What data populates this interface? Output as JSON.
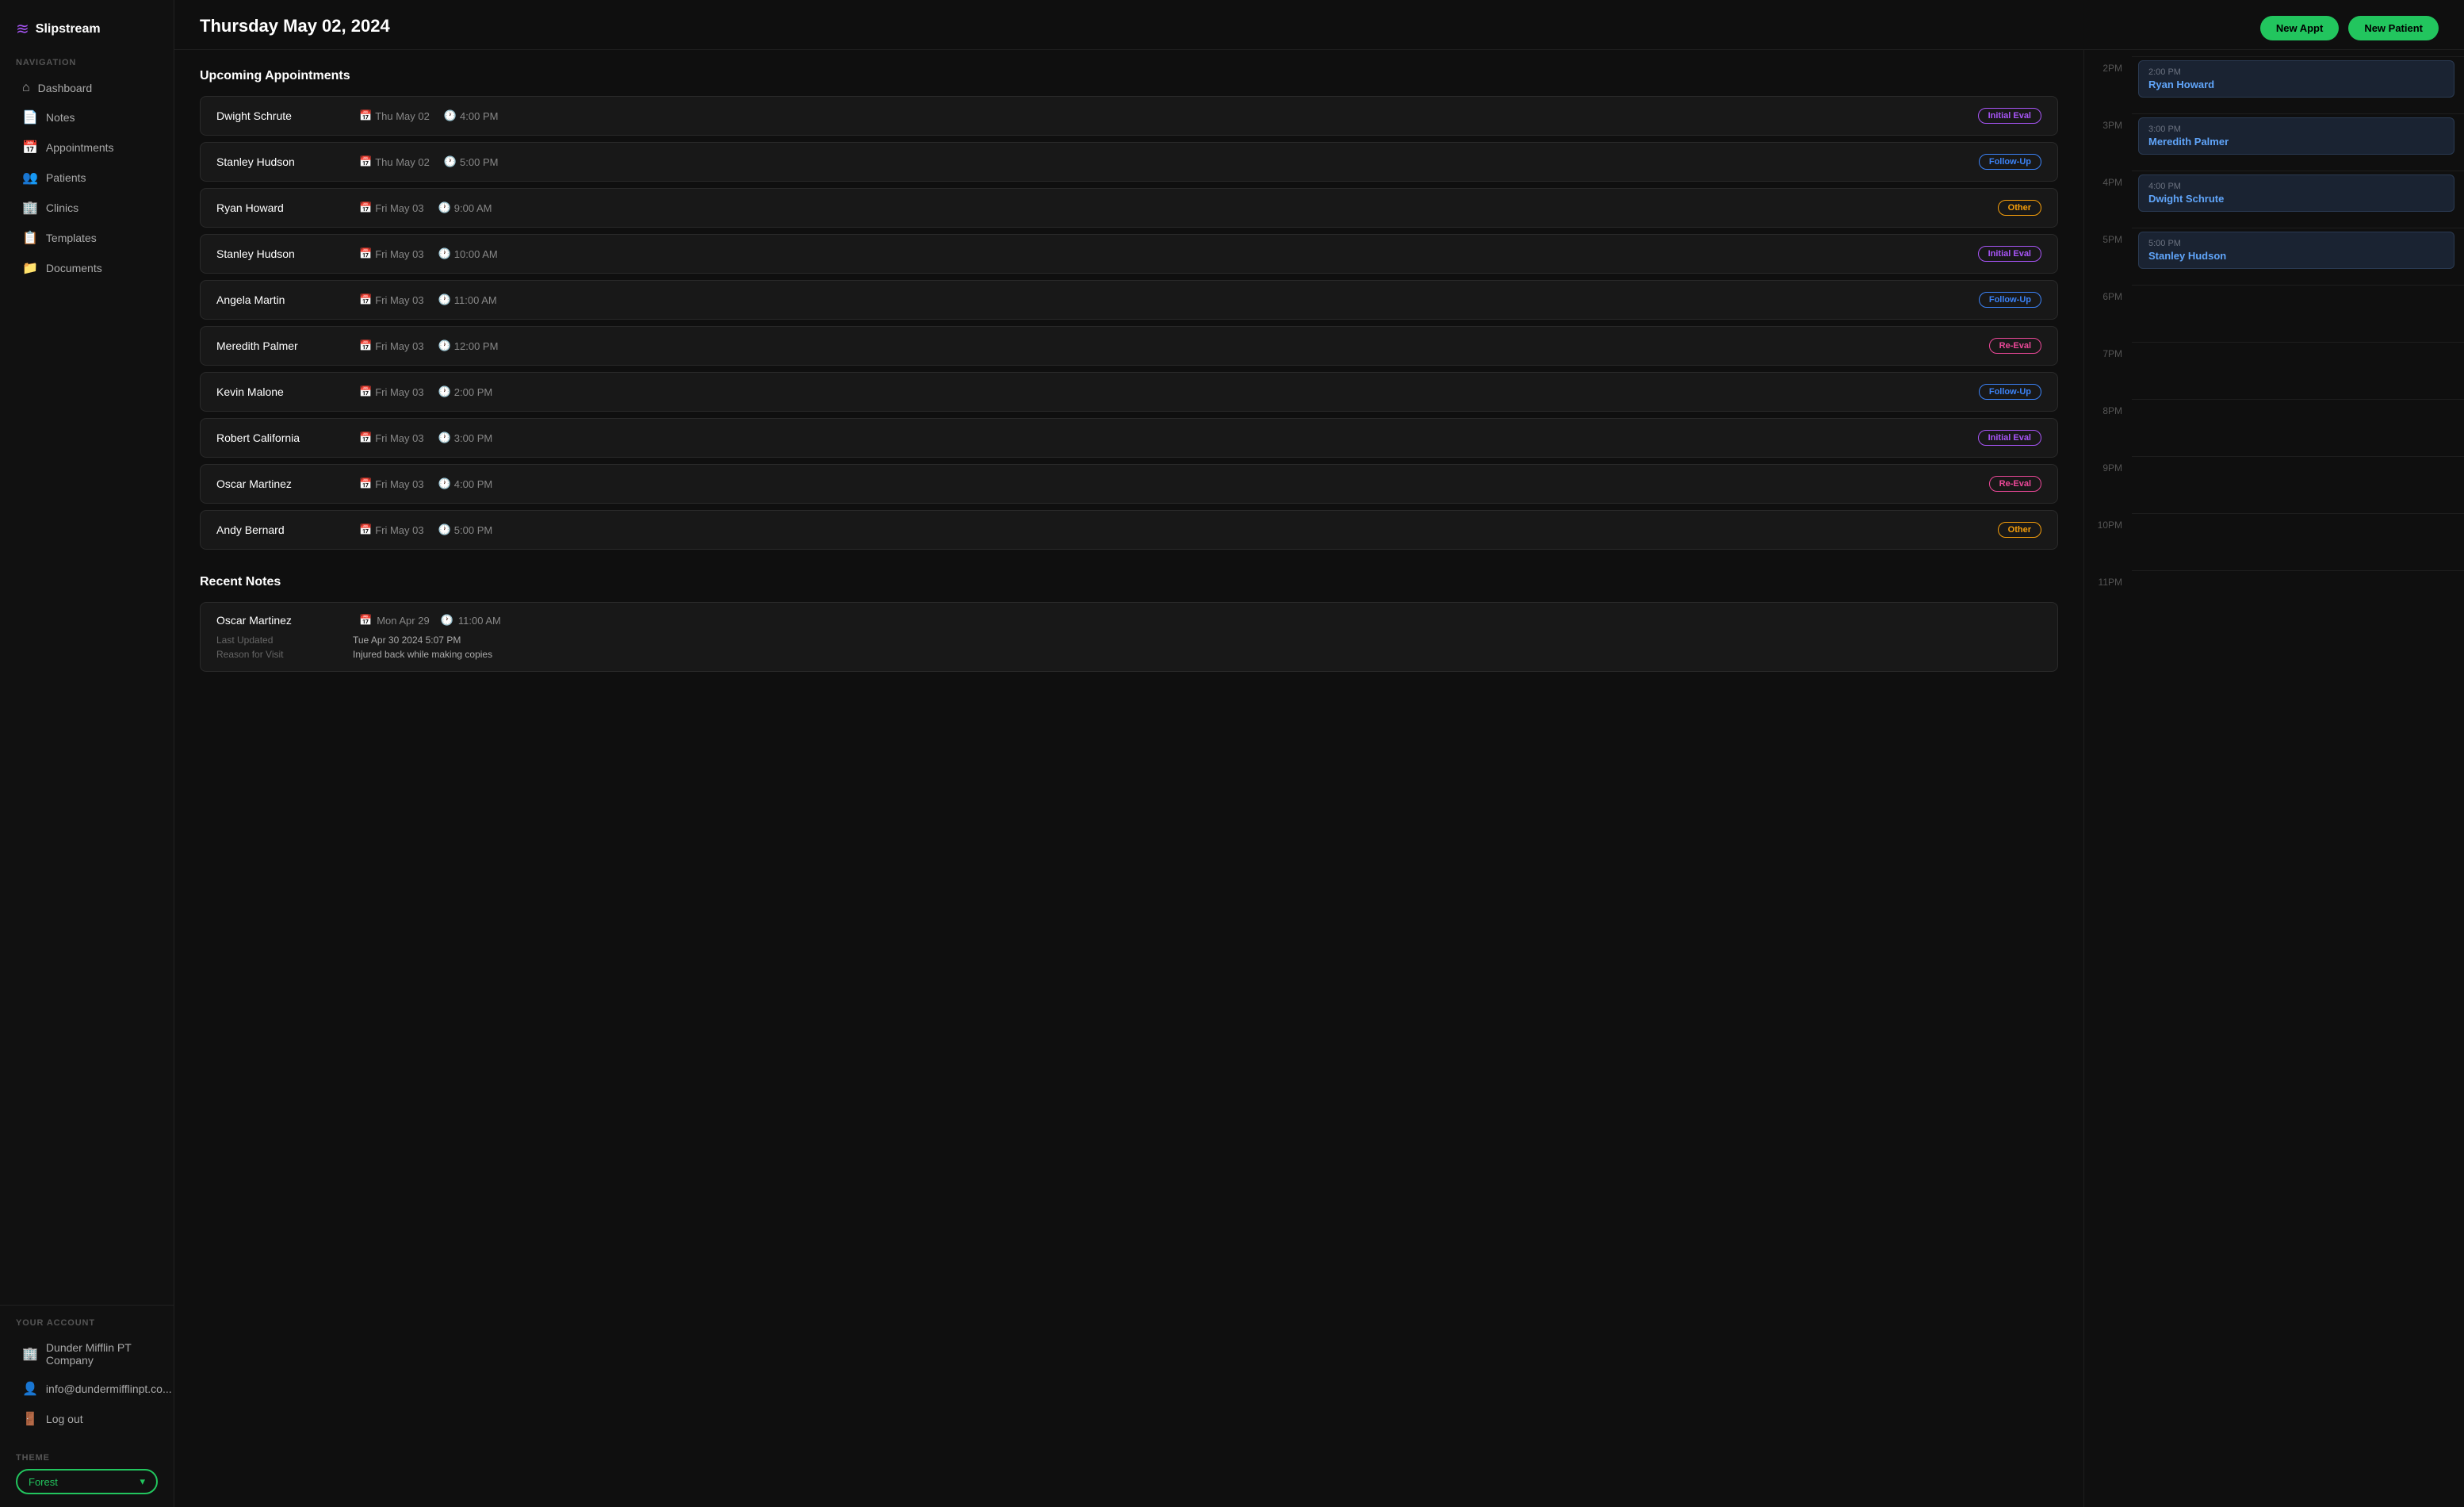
{
  "app": {
    "logo_icon": "≋",
    "logo_text": "Slipstream"
  },
  "sidebar": {
    "nav_label": "Navigation",
    "items": [
      {
        "id": "dashboard",
        "label": "Dashboard",
        "icon": "⌂"
      },
      {
        "id": "notes",
        "label": "Notes",
        "icon": "📄"
      },
      {
        "id": "appointments",
        "label": "Appointments",
        "icon": "📅"
      },
      {
        "id": "patients",
        "label": "Patients",
        "icon": "👥"
      },
      {
        "id": "clinics",
        "label": "Clinics",
        "icon": "🏢"
      },
      {
        "id": "templates",
        "label": "Templates",
        "icon": "📋"
      },
      {
        "id": "documents",
        "label": "Documents",
        "icon": "📁"
      }
    ],
    "account_label": "Your Account",
    "account_items": [
      {
        "id": "company",
        "label": "Dunder Mifflin PT Company",
        "icon": "🏢"
      },
      {
        "id": "email",
        "label": "info@dundermifflinpt.co...",
        "icon": "👤"
      },
      {
        "id": "logout",
        "label": "Log out",
        "icon": "🚪"
      }
    ],
    "theme_label": "Theme",
    "theme_value": "Forest"
  },
  "header": {
    "title": "Thursday May 02, 2024",
    "btn_new_appt": "New Appt",
    "btn_new_patient": "New Patient"
  },
  "upcoming": {
    "section_title": "Upcoming Appointments",
    "appointments": [
      {
        "name": "Dwight Schrute",
        "date": "Thu May 02",
        "time": "4:00 PM",
        "badge": "Initial Eval",
        "badge_type": "initial"
      },
      {
        "name": "Stanley Hudson",
        "date": "Thu May 02",
        "time": "5:00 PM",
        "badge": "Follow-Up",
        "badge_type": "followup"
      },
      {
        "name": "Ryan Howard",
        "date": "Fri May 03",
        "time": "9:00 AM",
        "badge": "Other",
        "badge_type": "other"
      },
      {
        "name": "Stanley Hudson",
        "date": "Fri May 03",
        "time": "10:00 AM",
        "badge": "Initial Eval",
        "badge_type": "initial"
      },
      {
        "name": "Angela Martin",
        "date": "Fri May 03",
        "time": "11:00 AM",
        "badge": "Follow-Up",
        "badge_type": "followup"
      },
      {
        "name": "Meredith Palmer",
        "date": "Fri May 03",
        "time": "12:00 PM",
        "badge": "Re-Eval",
        "badge_type": "reeval"
      },
      {
        "name": "Kevin Malone",
        "date": "Fri May 03",
        "time": "2:00 PM",
        "badge": "Follow-Up",
        "badge_type": "followup"
      },
      {
        "name": "Robert California",
        "date": "Fri May 03",
        "time": "3:00 PM",
        "badge": "Initial Eval",
        "badge_type": "initial"
      },
      {
        "name": "Oscar Martinez",
        "date": "Fri May 03",
        "time": "4:00 PM",
        "badge": "Re-Eval",
        "badge_type": "reeval"
      },
      {
        "name": "Andy Bernard",
        "date": "Fri May 03",
        "time": "5:00 PM",
        "badge": "Other",
        "badge_type": "other"
      }
    ]
  },
  "recent_notes": {
    "section_title": "Recent Notes",
    "notes": [
      {
        "name": "Oscar Martinez",
        "date": "Mon Apr 29",
        "time": "11:00 AM",
        "last_updated_label": "Last Updated",
        "last_updated_value": "Tue Apr 30 2024 5:07 PM",
        "reason_label": "Reason for Visit",
        "reason_value": "Injured back while making copies"
      }
    ]
  },
  "calendar": {
    "slots": [
      {
        "time": "2PM",
        "events": [
          {
            "time": "2:00 PM",
            "name": "Ryan Howard"
          }
        ]
      },
      {
        "time": "3PM",
        "events": [
          {
            "time": "3:00 PM",
            "name": "Meredith Palmer"
          }
        ]
      },
      {
        "time": "4PM",
        "events": [
          {
            "time": "4:00 PM",
            "name": "Dwight Schrute"
          }
        ]
      },
      {
        "time": "5PM",
        "events": [
          {
            "time": "5:00 PM",
            "name": "Stanley Hudson"
          }
        ]
      },
      {
        "time": "6PM",
        "events": []
      },
      {
        "time": "7PM",
        "events": []
      },
      {
        "time": "8PM",
        "events": []
      },
      {
        "time": "9PM",
        "events": []
      },
      {
        "time": "10PM",
        "events": []
      },
      {
        "time": "11PM",
        "events": []
      }
    ]
  }
}
